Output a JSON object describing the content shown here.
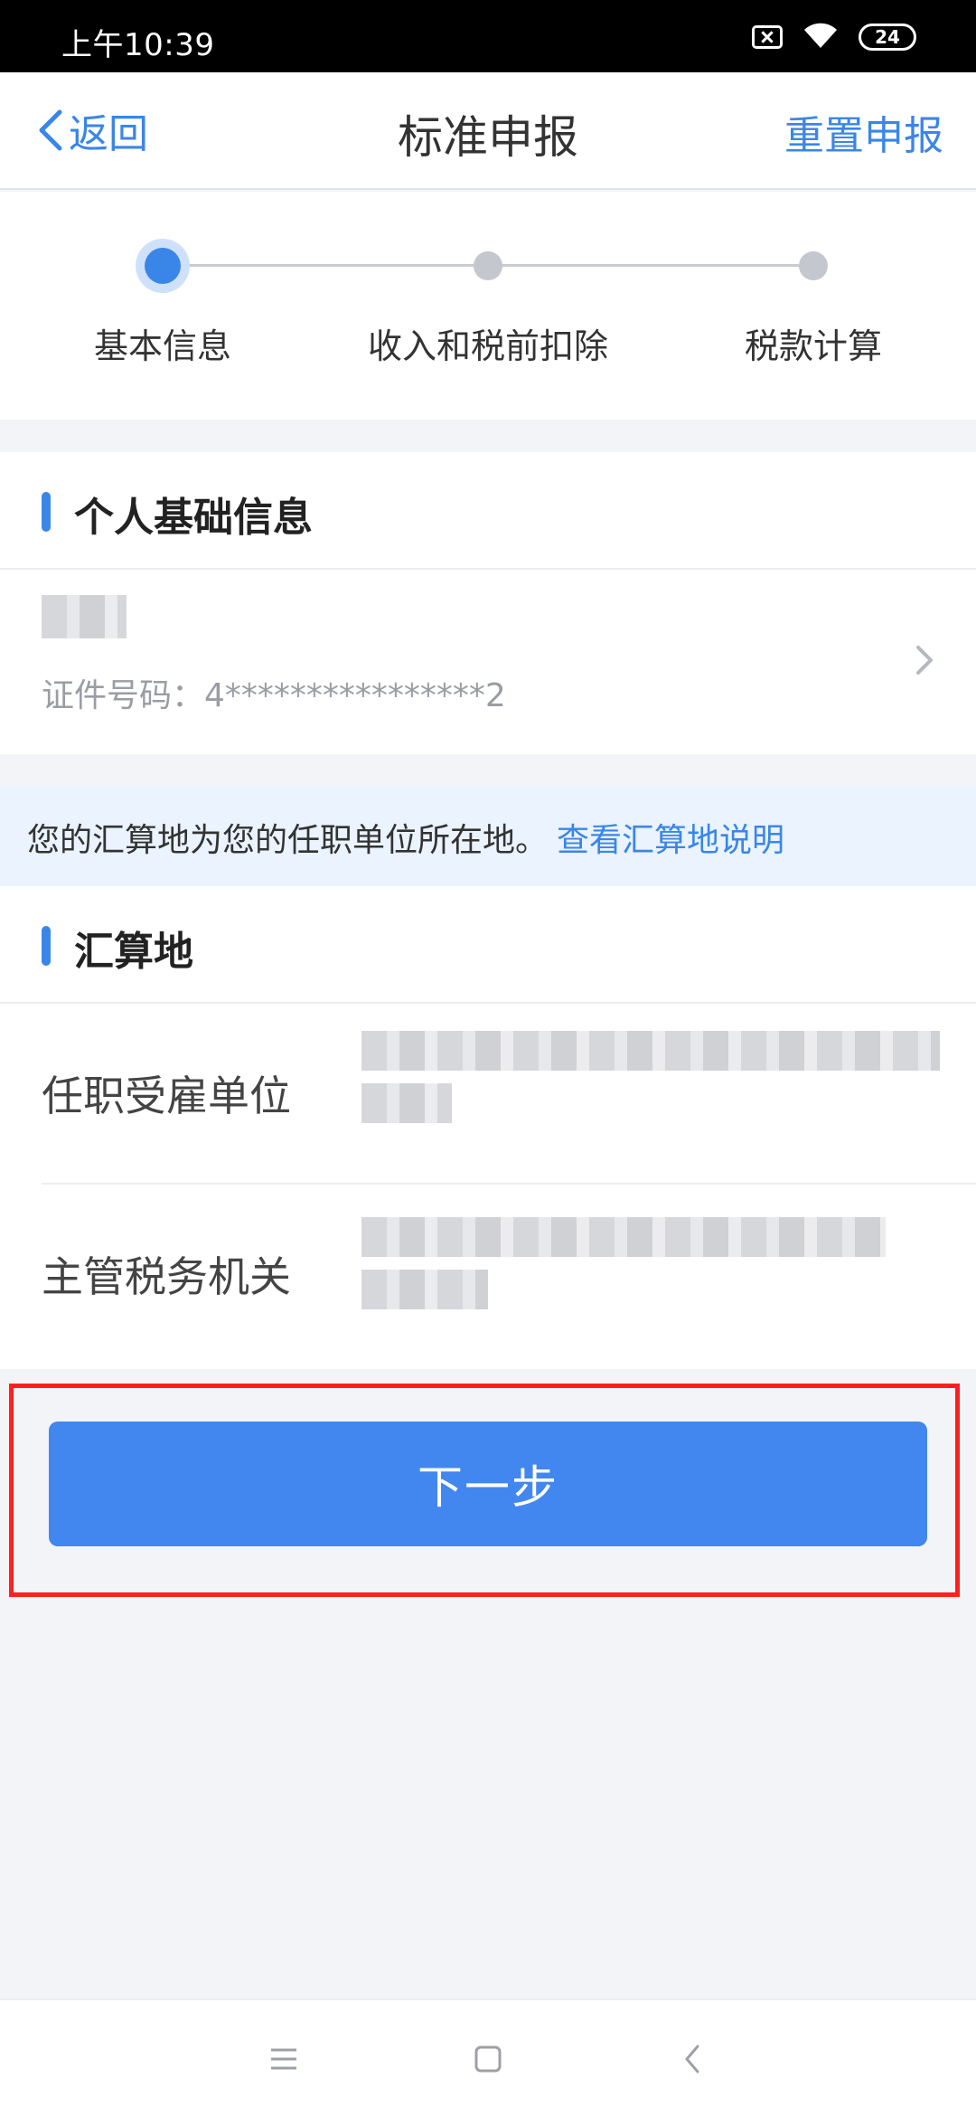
{
  "status_bar": {
    "time": "上午10:39",
    "battery": "24"
  },
  "nav": {
    "back_label": "返回",
    "title": "标准申报",
    "reset_label": "重置申报"
  },
  "stepper": {
    "steps": [
      {
        "label": "基本信息",
        "active": true
      },
      {
        "label": "收入和税前扣除",
        "active": false
      },
      {
        "label": "税款计算",
        "active": false
      }
    ]
  },
  "personal_info": {
    "title": "个人基础信息",
    "id_label": "证件号码：",
    "id_value": "4****************2"
  },
  "notice": {
    "text": "您的汇算地为您的任职单位所在地。",
    "link": "查看汇算地说明"
  },
  "settlement": {
    "title": "汇算地",
    "fields": [
      {
        "label": "任职受雇单位"
      },
      {
        "label": "主管税务机关"
      }
    ]
  },
  "actions": {
    "next_label": "下一步"
  },
  "colors": {
    "accent": "#3a86e8",
    "button": "#4287f0",
    "highlight_border": "#ff1f1f"
  }
}
